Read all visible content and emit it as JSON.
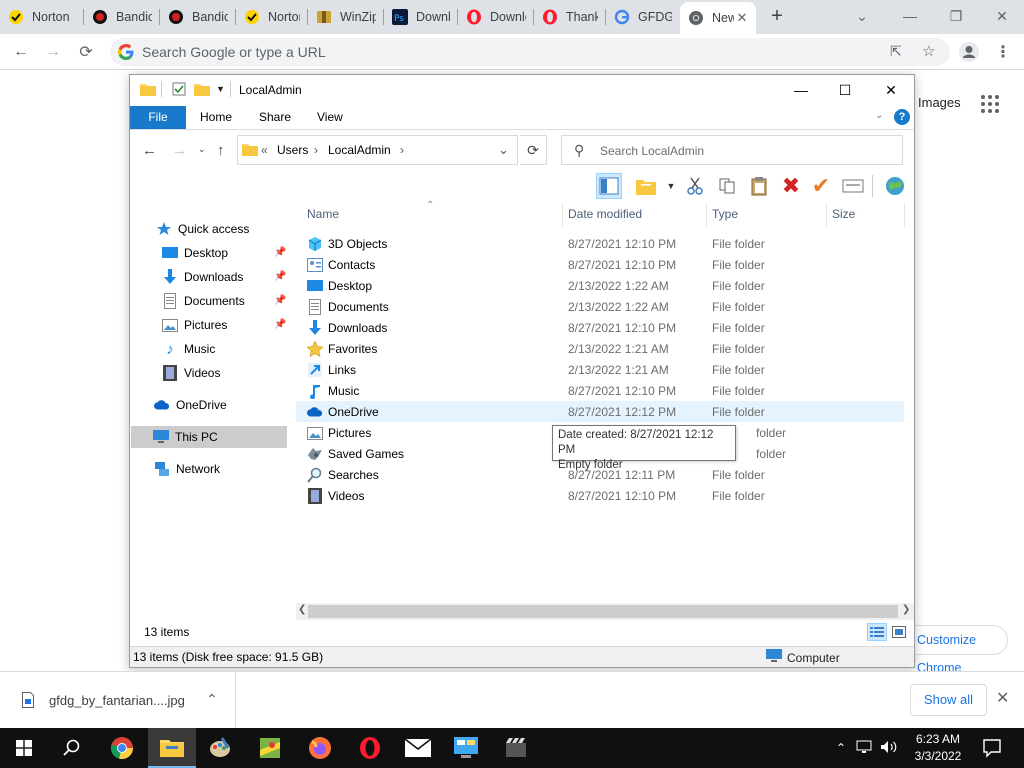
{
  "browser": {
    "tabs": [
      {
        "title": "Norton",
        "icon": "norton-icon"
      },
      {
        "title": "Bandicam",
        "icon": "bandicam-icon"
      },
      {
        "title": "Bandicam",
        "icon": "bandicam-icon"
      },
      {
        "title": "Norton",
        "icon": "norton-icon"
      },
      {
        "title": "WinZip",
        "icon": "winzip-icon"
      },
      {
        "title": "Download",
        "icon": "photoshop-icon"
      },
      {
        "title": "Download",
        "icon": "opera-icon"
      },
      {
        "title": "Thank",
        "icon": "opera-icon"
      },
      {
        "title": "GFDG",
        "icon": "google-icon"
      },
      {
        "title": "New Tab",
        "icon": "chrome-icon",
        "active": true
      }
    ],
    "new_tab_label": "+",
    "omnibox_placeholder": "Search Google or type a URL"
  },
  "page": {
    "images_link": "Images",
    "customize_label": "Customize Chrome"
  },
  "explorer": {
    "title": "LocalAdmin",
    "ribbon_tabs": {
      "file": "File",
      "home": "Home",
      "share": "Share",
      "view": "View"
    },
    "help": "?",
    "address": {
      "prefix": "«",
      "crumbs": [
        "Users",
        "LocalAdmin"
      ]
    },
    "search_placeholder": "Search LocalAdmin",
    "nav": {
      "quick_access": "Quick access",
      "quick_items": [
        "Desktop",
        "Downloads",
        "Documents",
        "Pictures",
        "Music",
        "Videos"
      ],
      "onedrive": "OneDrive",
      "this_pc": "This PC",
      "network": "Network"
    },
    "columns": {
      "name": "Name",
      "date": "Date modified",
      "type": "Type",
      "size": "Size"
    },
    "files": [
      {
        "name": "3D Objects",
        "date": "8/27/2021 12:10 PM",
        "type": "File folder",
        "icon": "3d-objects-icon"
      },
      {
        "name": "Contacts",
        "date": "8/27/2021 12:10 PM",
        "type": "File folder",
        "icon": "contacts-icon"
      },
      {
        "name": "Desktop",
        "date": "2/13/2022 1:22 AM",
        "type": "File folder",
        "icon": "desktop-icon"
      },
      {
        "name": "Documents",
        "date": "2/13/2022 1:22 AM",
        "type": "File folder",
        "icon": "documents-icon"
      },
      {
        "name": "Downloads",
        "date": "8/27/2021 12:10 PM",
        "type": "File folder",
        "icon": "downloads-icon"
      },
      {
        "name": "Favorites",
        "date": "2/13/2022 1:21 AM",
        "type": "File folder",
        "icon": "favorites-icon"
      },
      {
        "name": "Links",
        "date": "2/13/2022 1:21 AM",
        "type": "File folder",
        "icon": "links-icon"
      },
      {
        "name": "Music",
        "date": "8/27/2021 12:10 PM",
        "type": "File folder",
        "icon": "music-icon"
      },
      {
        "name": "OneDrive",
        "date": "8/27/2021 12:12 PM",
        "type": "File folder",
        "icon": "onedrive-icon"
      },
      {
        "name": "Pictures",
        "date": "",
        "type": "folder",
        "icon": "pictures-icon"
      },
      {
        "name": "Saved Games",
        "date": "",
        "type": "folder",
        "icon": "saved-games-icon"
      },
      {
        "name": "Searches",
        "date": "8/27/2021 12:11 PM",
        "type": "File folder",
        "icon": "searches-icon"
      },
      {
        "name": "Videos",
        "date": "8/27/2021 12:10 PM",
        "type": "File folder",
        "icon": "videos-icon"
      }
    ],
    "tooltip": {
      "line1": "Date created: 8/27/2021 12:12 PM",
      "line2": "Empty folder"
    },
    "item_count": "13 items",
    "status_left": "13 items (Disk free space: 91.5 GB)",
    "status_right": "Computer"
  },
  "downloads": {
    "file_name": "gfdg_by_fantarian....jpg",
    "show_all": "Show all"
  },
  "taskbar": {
    "time": "6:23 AM",
    "date": "3/3/2022"
  },
  "colors": {
    "accent_blue": "#1979ca",
    "chrome_link": "#1a73e8",
    "hover_row": "#e5f3ff"
  }
}
